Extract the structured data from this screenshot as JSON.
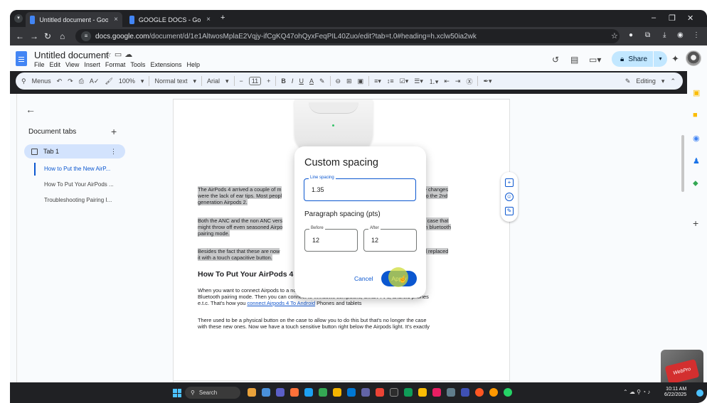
{
  "browser": {
    "tabs": [
      {
        "title": "Untitled document - Google Docs",
        "close": "×"
      },
      {
        "title": "GOOGLE DOCS - Google Docs",
        "close": "×"
      }
    ],
    "new_tab": "+",
    "window_controls": {
      "minimize": "–",
      "maximize": "❐",
      "close": "✕"
    },
    "url_domain": "docs.google.com",
    "url_path": "/document/d/1e1AltwosMplaE2Vqjy-ifCgKQ47ohQyxFeqPIL40Zuo/edit?tab=t.0#heading=h.xclw50ia2wk"
  },
  "docs": {
    "title": "Untitled document",
    "menu": [
      "File",
      "Edit",
      "View",
      "Insert",
      "Format",
      "Tools",
      "Extensions",
      "Help"
    ],
    "share_label": "Share",
    "toolbar": {
      "menus": "Menus",
      "zoom": "100%",
      "style": "Normal text",
      "font": "Arial",
      "font_size": "11",
      "editing": "Editing"
    }
  },
  "doc_tabs": {
    "header": "Document tabs",
    "tab_name": "Tab 1",
    "outline": [
      "How to Put the New AirP...",
      "How To Put Your AirPods ...",
      "Troubleshooting Pairing I..."
    ]
  },
  "document": {
    "p1_left": "The AirPods 4 arrived a couple of m",
    "p1_right": "of the changes",
    "p1_l2_left": "were the lack of ear tips. Most peopl",
    "p1_l2_right": "ed to the 2nd",
    "p1_l3": "generation Airpods 2.",
    "p2_left": "Both the ANC and the non ANC vers",
    "p2_right": "ated case that",
    "p2_l2_left": "might throw off even seasoned Airpo",
    "p2_l2_right": "em in bluetooth",
    "p2_l3": "pairing mode.",
    "p3_left": "Besides the fact that these are now",
    "p3_right": "n and replaced",
    "p3_l2": "it with a touch capacitive button.",
    "heading": "How To Put Your AirPods 4 i",
    "p4_l1": "When you want to connect Airpods to a non-Apple device, you have to manually put them in",
    "p4_l2": "Bluetooth pairing mode. Then you can connect to Windows computers, Smart TV's, android phones",
    "p4_l3_a": "e.t.c. That's how you ",
    "p4_link": "connect Airpods 4 To Android",
    "p4_l3_b": " Phones and tablets",
    "p5_l1": "There used to be a physical button on the case to allow you to do this but that's no longer the case",
    "p5_l2": "with these new ones. Now we have a touch sensitive button right below the Airpods light. It's exactly"
  },
  "dialog": {
    "title": "Custom spacing",
    "line_spacing_label": "Line spacing",
    "line_spacing_value": "1.35",
    "paragraph_spacing_title": "Paragraph spacing (pts)",
    "before_label": "Before",
    "before_value": "12",
    "after_label": "After",
    "after_value": "12",
    "cancel": "Cancel",
    "apply": "Apply"
  },
  "taskbar": {
    "search": "Search",
    "time": "10:11 AM",
    "date": "6/22/2025"
  },
  "watermark": "WebPro",
  "colors": {
    "accent": "#0b57d0",
    "share_bg": "#c2e7ff",
    "toolbar_bg": "#edf2fa",
    "cursor_highlight": "#cddc39"
  }
}
